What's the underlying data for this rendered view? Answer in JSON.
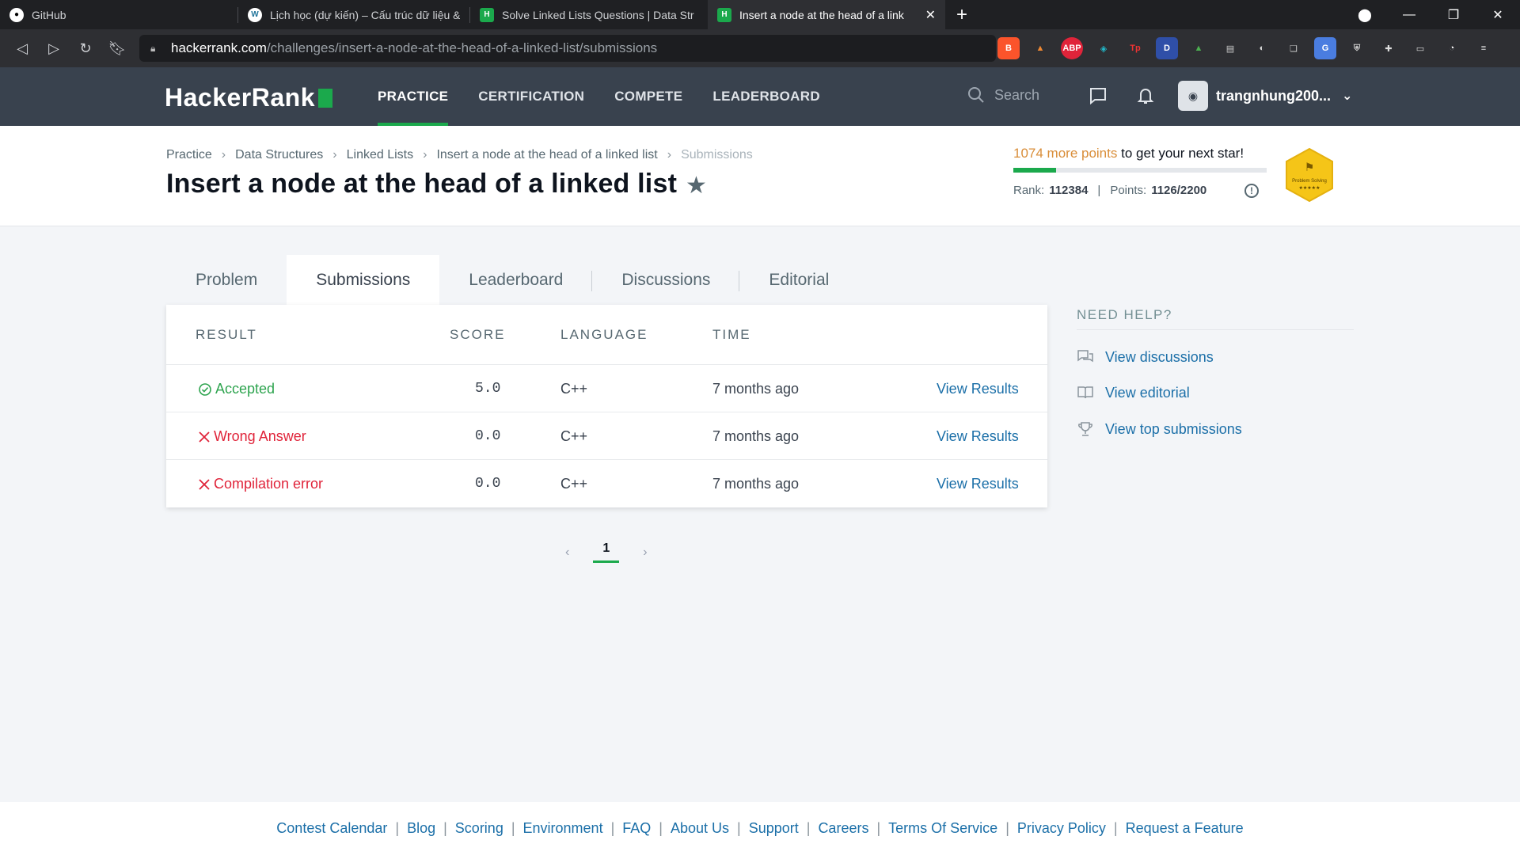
{
  "browser": {
    "tabs": [
      {
        "title": "GitHub",
        "icon": "github-icon"
      },
      {
        "title": "Lịch học (dự kiến) – Cấu trúc dữ liệu &",
        "icon": "wordpress-icon"
      },
      {
        "title": "Solve Linked Lists Questions | Data Str",
        "icon": "hackerrank-icon"
      },
      {
        "title": "Insert a node at the head of a link",
        "icon": "hackerrank-icon"
      }
    ],
    "url_host": "hackerrank.com",
    "url_path": "/challenges/insert-a-node-at-the-head-of-a-linked-list/submissions"
  },
  "header": {
    "logo": "HackerRank",
    "nav": [
      "PRACTICE",
      "CERTIFICATION",
      "COMPETE",
      "LEADERBOARD"
    ],
    "search_placeholder": "Search",
    "username": "trangnhung200..."
  },
  "breadcrumb": [
    "Practice",
    "Data Structures",
    "Linked Lists",
    "Insert a node at the head of a linked list",
    "Submissions"
  ],
  "page_title": "Insert a node at the head of a linked list",
  "star": {
    "points_needed": "1074 more points",
    "suffix": " to get your next star!",
    "progress_fraction": 0.17,
    "rank_label": "Rank:",
    "rank": "112384",
    "points_label": "Points:",
    "points": "1126/2200",
    "badge_text": "Problem Solving",
    "badge_stars": "★★★★★"
  },
  "tabs": [
    "Problem",
    "Submissions",
    "Leaderboard",
    "Discussions",
    "Editorial"
  ],
  "table": {
    "headers": [
      "RESULT",
      "SCORE",
      "LANGUAGE",
      "TIME"
    ],
    "rows": [
      {
        "result": "Accepted",
        "status": "accepted",
        "score": "5.0",
        "language": "C++",
        "time": "7 months ago",
        "action": "View Results"
      },
      {
        "result": "Wrong Answer",
        "status": "failed",
        "score": "0.0",
        "language": "C++",
        "time": "7 months ago",
        "action": "View Results"
      },
      {
        "result": "Compilation error",
        "status": "failed",
        "score": "0.0",
        "language": "C++",
        "time": "7 months ago",
        "action": "View Results"
      }
    ]
  },
  "pagination": {
    "current": "1"
  },
  "help": {
    "title": "NEED HELP?",
    "links": [
      "View discussions",
      "View editorial",
      "View top submissions"
    ]
  },
  "footer": [
    "Contest Calendar",
    "Blog",
    "Scoring",
    "Environment",
    "FAQ",
    "About Us",
    "Support",
    "Careers",
    "Terms Of Service",
    "Privacy Policy",
    "Request a Feature"
  ],
  "colors": {
    "accent": "#1ba94c",
    "link": "#1b6fa8",
    "header_bg": "#39424e",
    "accepted": "#2ea44f",
    "failed": "#e0243a"
  }
}
